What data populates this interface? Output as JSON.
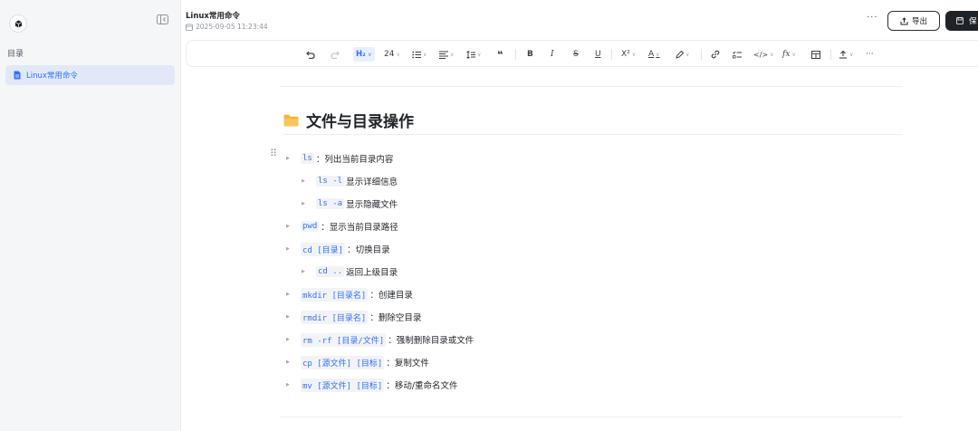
{
  "sidebar": {
    "section_title": "目录",
    "items": [
      {
        "label": "Linux常用命令",
        "active": true
      }
    ]
  },
  "header": {
    "title": "Linux常用命令",
    "timestamp": "2025-09-05 11:23:44",
    "more_label": "···",
    "export_label": "导出",
    "save_label": "保"
  },
  "toolbar": {
    "heading_label": "H₂",
    "font_size": "24",
    "more_label": "···"
  },
  "content": {
    "heading": "文件与目录操作",
    "items": [
      {
        "level": 1,
        "code": "ls",
        "text": "：列出当前目录内容"
      },
      {
        "level": 2,
        "code": "ls -l",
        "text": "显示详细信息"
      },
      {
        "level": 2,
        "code": "ls -a",
        "text": "显示隐藏文件"
      },
      {
        "level": 1,
        "code": "pwd",
        "text": "：显示当前目录路径"
      },
      {
        "level": 1,
        "code": "cd [目录]",
        "text": "：切换目录"
      },
      {
        "level": 2,
        "code": "cd ..",
        "text": "返回上级目录"
      },
      {
        "level": 1,
        "code": "mkdir [目录名]",
        "text": "：创建目录"
      },
      {
        "level": 1,
        "code": "rmdir [目录名]",
        "text": "：删除空目录"
      },
      {
        "level": 1,
        "code": "rm -rf [目录/文件]",
        "text": "：强制删除目录或文件"
      },
      {
        "level": 1,
        "code": "cp [源文件] [目标]",
        "text": "：复制文件"
      },
      {
        "level": 1,
        "code": "mv [源文件] [目标]",
        "text": "：移动/重命名文件"
      }
    ]
  },
  "colors": {
    "accent": "#3370ff",
    "sidebar_bg": "#f5f6f7",
    "active_item_bg": "#e1e9f8",
    "primary_button_bg": "#1f2329",
    "folder": "#f5b63a"
  }
}
